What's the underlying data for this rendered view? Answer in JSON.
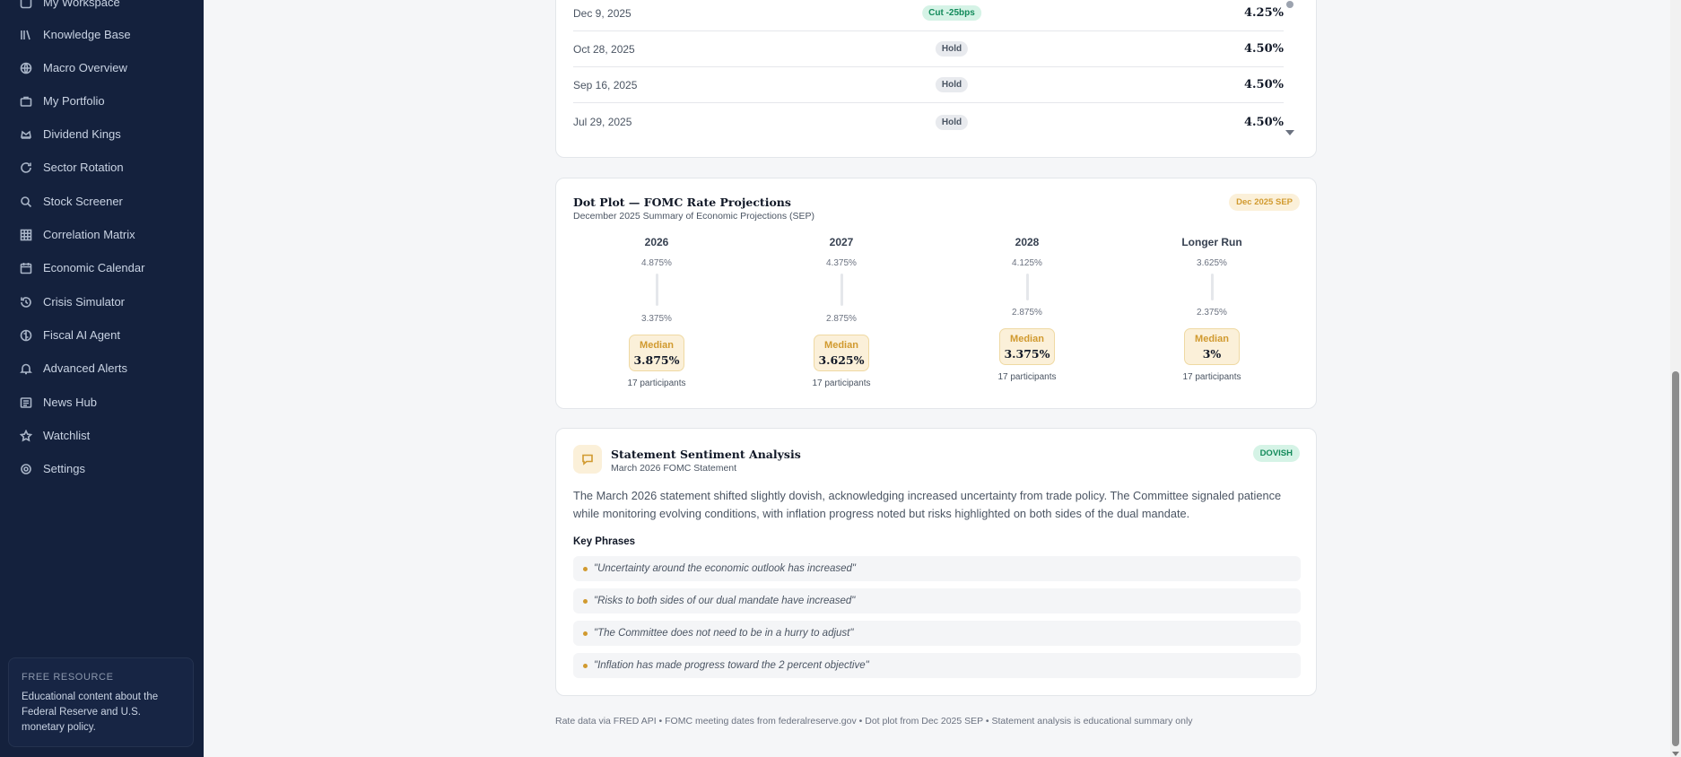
{
  "sidebar": {
    "items": [
      {
        "label": "My Workspace",
        "icon": "workspace-icon"
      },
      {
        "label": "Knowledge Base",
        "icon": "library-icon"
      },
      {
        "label": "Macro Overview",
        "icon": "globe-icon"
      },
      {
        "label": "My Portfolio",
        "icon": "briefcase-icon"
      },
      {
        "label": "Dividend Kings",
        "icon": "crown-icon"
      },
      {
        "label": "Sector Rotation",
        "icon": "rotate-icon"
      },
      {
        "label": "Stock Screener",
        "icon": "search-icon"
      },
      {
        "label": "Correlation Matrix",
        "icon": "grid-icon"
      },
      {
        "label": "Economic Calendar",
        "icon": "calendar-icon"
      },
      {
        "label": "Crisis Simulator",
        "icon": "history-icon"
      },
      {
        "label": "Fiscal AI Agent",
        "icon": "brain-icon"
      },
      {
        "label": "Advanced Alerts",
        "icon": "bell-icon"
      },
      {
        "label": "News Hub",
        "icon": "newspaper-icon"
      },
      {
        "label": "Watchlist",
        "icon": "star-icon"
      },
      {
        "label": "Settings",
        "icon": "gear-icon"
      }
    ],
    "promo": {
      "kicker": "FREE RESOURCE",
      "text": "Educational content about the Federal Reserve and U.S. monetary policy."
    }
  },
  "meetings": [
    {
      "date": "Dec 9, 2025",
      "decision": "Cut -25bps",
      "rate": "4.25%"
    },
    {
      "date": "Oct 28, 2025",
      "decision": "Hold",
      "rate": "4.50%"
    },
    {
      "date": "Sep 16, 2025",
      "decision": "Hold",
      "rate": "4.50%"
    },
    {
      "date": "Jul 29, 2025",
      "decision": "Hold",
      "rate": "4.50%"
    }
  ],
  "dot_plot": {
    "title": "Dot Plot — FOMC Rate Projections",
    "subtitle": "December 2025 Summary of Economic Projections (SEP)",
    "badge": "Dec 2025 SEP",
    "columns": [
      {
        "year": "2026",
        "high": "4.875%",
        "low": "3.375%",
        "median_label": "Median",
        "median": "3.875%",
        "participants": "17 participants"
      },
      {
        "year": "2027",
        "high": "4.375%",
        "low": "2.875%",
        "median_label": "Median",
        "median": "3.625%",
        "participants": "17 participants"
      },
      {
        "year": "2028",
        "high": "4.125%",
        "low": "2.875%",
        "median_label": "Median",
        "median": "3.375%",
        "participants": "17 participants"
      },
      {
        "year": "Longer Run",
        "high": "3.625%",
        "low": "2.375%",
        "median_label": "Median",
        "median": "3%",
        "participants": "17 participants"
      }
    ]
  },
  "sentiment": {
    "title": "Statement Sentiment Analysis",
    "subtitle": "March 2026 FOMC Statement",
    "badge": "DOVISH",
    "summary": "The March 2026 statement shifted slightly dovish, acknowledging increased uncertainty from trade policy. The Committee signaled patience while monitoring evolving conditions, with inflation progress noted but risks highlighted on both sides of the dual mandate.",
    "key_phrases_title": "Key Phrases",
    "phrases": [
      "\"Uncertainty around the economic outlook has increased\"",
      "\"Risks to both sides of our dual mandate have increased\"",
      "\"The Committee does not need to be in a hurry to adjust\"",
      "\"Inflation has made progress toward the 2 percent objective\""
    ]
  },
  "footer": "Rate data via FRED API • FOMC meeting dates from federalreserve.gov • Dot plot from Dec 2025 SEP • Statement analysis is educational summary only",
  "colors": {
    "sidebar_bg": "#14213d",
    "accent_gold": "#d19a2f",
    "dovish_green": "#128a5a"
  }
}
